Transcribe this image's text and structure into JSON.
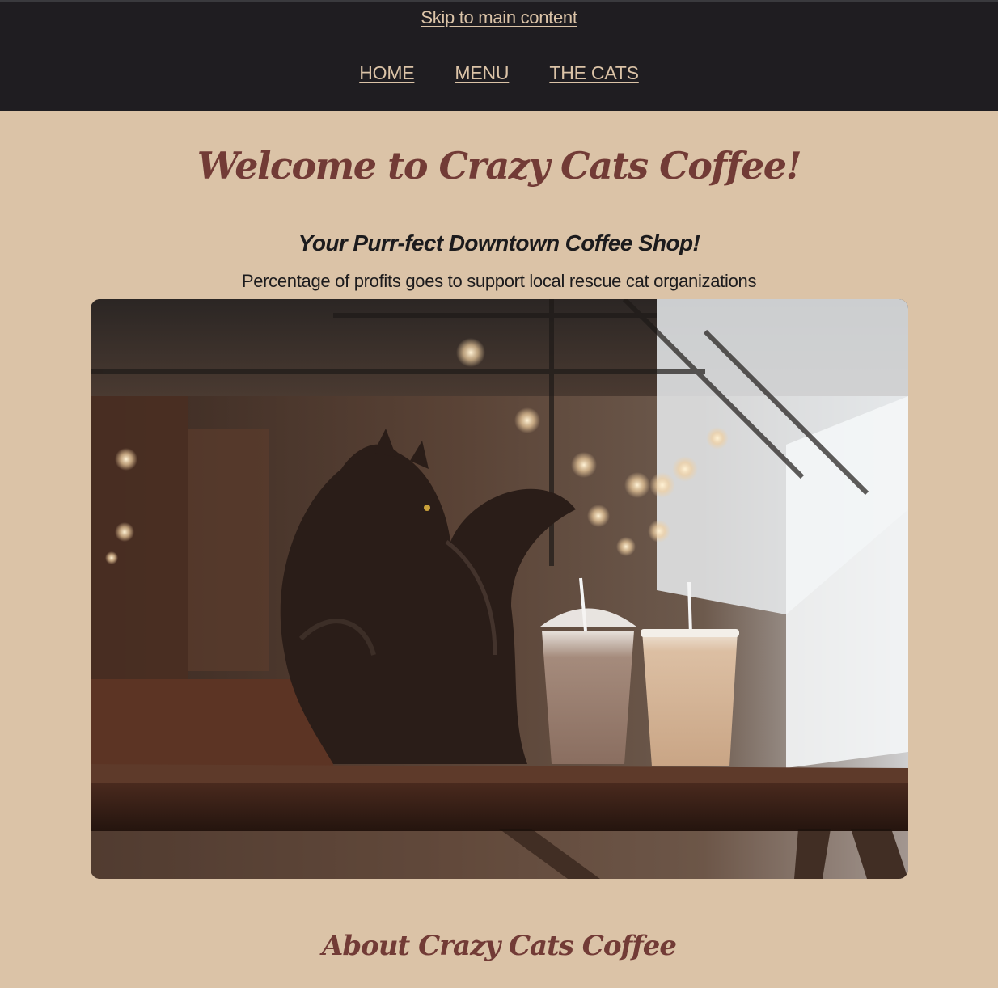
{
  "header": {
    "skip_link": "Skip to main content",
    "nav": [
      "HOME",
      "MENU",
      "THE CATS"
    ]
  },
  "hero": {
    "title": "Welcome to Crazy Cats Coffee!",
    "tagline": "Your Purr-fect Downtown Coffee Shop!",
    "subline": "Percentage of profits goes to support local rescue cat organizations"
  },
  "about": {
    "title": "About Crazy Cats Coffee"
  },
  "colors": {
    "page_bg": "#dbc3a7",
    "header_bg": "#1f1d21",
    "link": "#dbc3a7",
    "heading": "#723b36",
    "text": "#1c1b1d"
  }
}
